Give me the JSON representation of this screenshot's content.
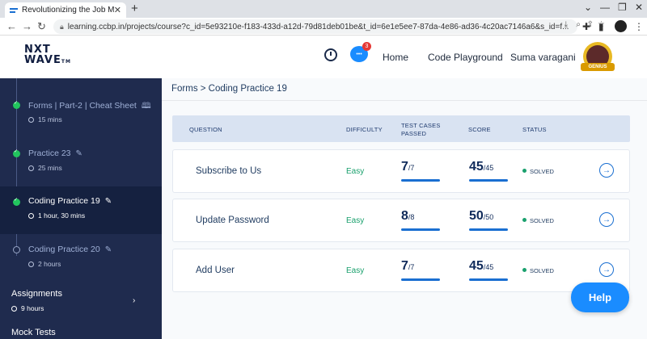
{
  "browser": {
    "tab_title": "Revolutionizing the Job Market | ",
    "url": "learning.ccbp.in/projects/course?c_id=5e93210e-f183-433d-a12d-79d81deb01be&t_id=6e1e5ee7-87da-4e86-ad36-4c20ac7146a6&s_id=f..."
  },
  "header": {
    "logo_line1": "NXT",
    "logo_line2": "WAVE",
    "logo_tm": "TM",
    "chat_badge": "3",
    "nav_home": "Home",
    "nav_code_playground": "Code Playground",
    "user_name": "Suma varagani",
    "avatar_badge": "GENIUS"
  },
  "sidebar": {
    "items": [
      {
        "title": "Forms | Part-2 | Cheat Sheet",
        "time": "15 mins"
      },
      {
        "title": "Practice 23",
        "time": "25 mins"
      },
      {
        "title": "Coding Practice 19",
        "time": "1 hour, 30 mins"
      },
      {
        "title": "Coding Practice 20",
        "time": "2 hours"
      }
    ],
    "sections": [
      {
        "title": "Assignments",
        "time": "9 hours"
      },
      {
        "title": "Mock Tests"
      }
    ]
  },
  "main": {
    "breadcrumb": "Forms > Coding Practice 19",
    "columns": {
      "question": "QUESTION",
      "difficulty": "DIFFICULTY",
      "test_cases_1": "TEST CASES",
      "test_cases_2": "PASSED",
      "score": "SCORE",
      "status": "STATUS"
    },
    "rows": [
      {
        "question": "Subscribe to Us",
        "difficulty": "Easy",
        "passed": "7",
        "total": "/7",
        "score": "45",
        "max": "/45",
        "status": "SOLVED"
      },
      {
        "question": "Update Password",
        "difficulty": "Easy",
        "passed": "8",
        "total": "/8",
        "score": "50",
        "max": "/50",
        "status": "SOLVED"
      },
      {
        "question": "Add User",
        "difficulty": "Easy",
        "passed": "7",
        "total": "/7",
        "score": "45",
        "max": "/45",
        "status": "SOLVED"
      }
    ]
  },
  "help_label": "Help",
  "colors": {
    "sidebar_bg": "#1f2b4e",
    "accent_blue": "#1a8cff",
    "easy_green": "#1aa06d"
  }
}
